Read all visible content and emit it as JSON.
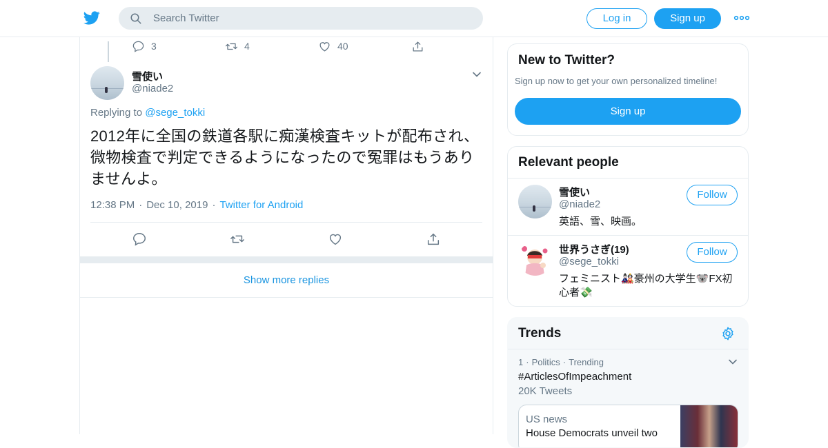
{
  "topbar": {
    "search_placeholder": "Search Twitter",
    "login_label": "Log in",
    "signup_label": "Sign up",
    "accent": "#1da1f2"
  },
  "prev_tweet": {
    "replies": "3",
    "retweets": "4",
    "likes": "40"
  },
  "tweet": {
    "display_name": "雪使い",
    "handle": "@niade2",
    "replying_prefix": "Replying to",
    "replying_to": "@sege_tokki",
    "text": "2012年に全国の鉄道各駅に痴漢検査キットが配布され、微物検査で判定できるようになったので冤罪はもうありませんよ。",
    "time": "12:38 PM",
    "date": "Dec 10, 2019",
    "source": "Twitter for Android"
  },
  "show_more_replies": "Show more replies",
  "new_to_twitter": {
    "title": "New to Twitter?",
    "subtitle": "Sign up now to get your own personalized timeline!",
    "button": "Sign up"
  },
  "relevant_people": {
    "title": "Relevant people",
    "people": [
      {
        "name": "雪使い",
        "handle": "@niade2",
        "bio": "英語、雪、映画。",
        "follow": "Follow"
      },
      {
        "name": "世界うさぎ(19)",
        "handle": "@sege_tokki",
        "bio": "フェミニスト🎎豪州の大学生🐨FX初心者💸",
        "follow": "Follow"
      }
    ]
  },
  "trends": {
    "title": "Trends",
    "items": [
      {
        "rank": "1",
        "category": "Politics",
        "label": "Trending",
        "tag": "#ArticlesOfImpeachment",
        "count": "20K Tweets"
      }
    ],
    "news": {
      "source": "US news",
      "headline": "House Democrats unveil two"
    }
  }
}
